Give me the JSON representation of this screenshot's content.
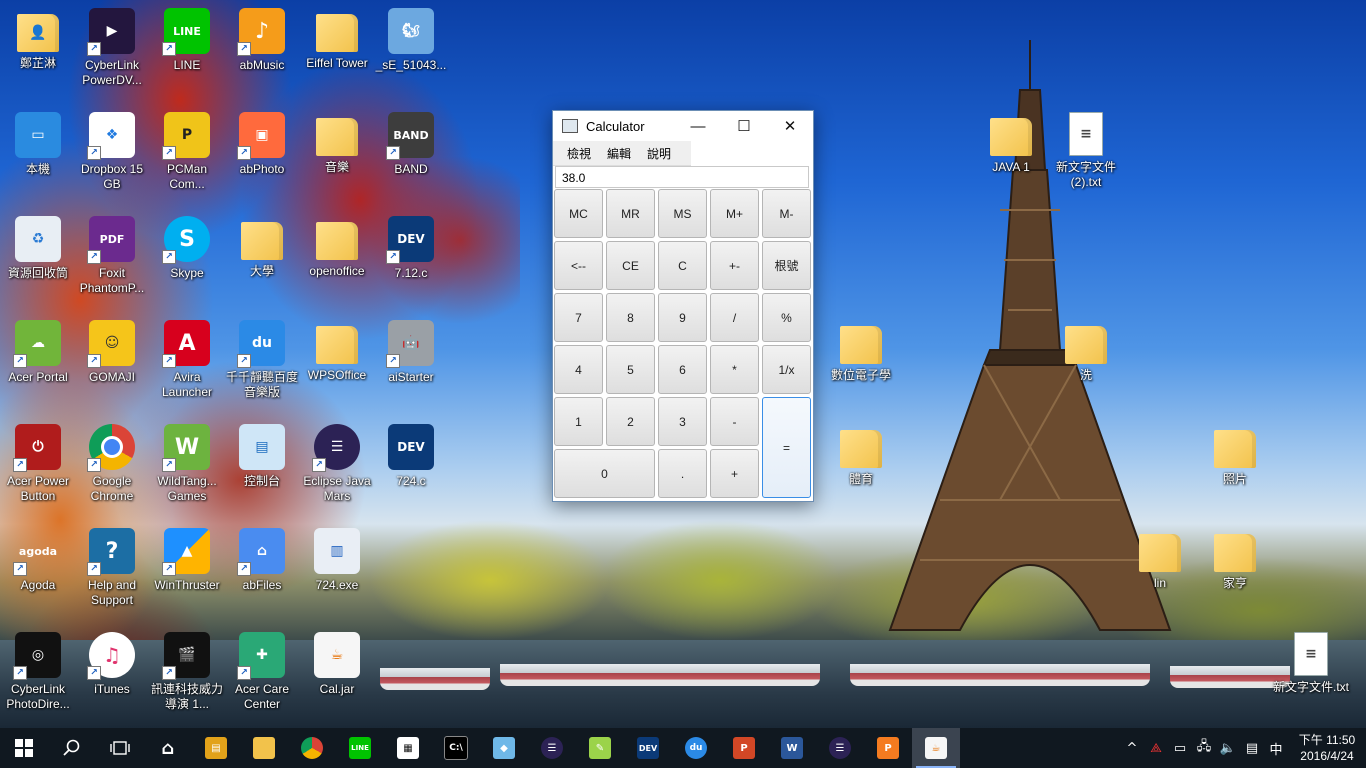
{
  "desktop": {
    "icons": [
      {
        "label": "鄭芷淋"
      },
      {
        "label": "CyberLink PowerDV..."
      },
      {
        "label": "LINE"
      },
      {
        "label": "abMusic"
      },
      {
        "label": "Eiffel Tower"
      },
      {
        "label": "_sE_51043..."
      },
      {
        "label": "本機"
      },
      {
        "label": "Dropbox 15 GB"
      },
      {
        "label": "PCMan Com..."
      },
      {
        "label": "abPhoto"
      },
      {
        "label": "音樂"
      },
      {
        "label": "BAND"
      },
      {
        "label": "資源回收筒"
      },
      {
        "label": "Foxit PhantomP..."
      },
      {
        "label": "Skype"
      },
      {
        "label": "大學"
      },
      {
        "label": "openoffice"
      },
      {
        "label": "7.12.c"
      },
      {
        "label": "Acer Portal"
      },
      {
        "label": "GOMAJI"
      },
      {
        "label": "Avira Launcher"
      },
      {
        "label": "千千靜聽百度音樂版"
      },
      {
        "label": "WPSOffice"
      },
      {
        "label": "aiStarter"
      },
      {
        "label": "Acer Power Button"
      },
      {
        "label": "Google Chrome"
      },
      {
        "label": "WildTang... Games"
      },
      {
        "label": "控制台"
      },
      {
        "label": "Eclipse Java Mars"
      },
      {
        "label": "724.c"
      },
      {
        "label": "Agoda"
      },
      {
        "label": "Help and Support"
      },
      {
        "label": "WinThruster"
      },
      {
        "label": "abFiles"
      },
      {
        "label": "724.exe"
      },
      {
        "label": "CyberLink PhotoDire..."
      },
      {
        "label": "iTunes"
      },
      {
        "label": "訊連科技威力導演 1..."
      },
      {
        "label": "Acer Care Center"
      },
      {
        "label": "Cal.jar"
      },
      {
        "label": "JAVA 1"
      },
      {
        "label": "新文字文件 (2).txt"
      },
      {
        "label": "數位電子學"
      },
      {
        "label": "洗"
      },
      {
        "label": "體育"
      },
      {
        "label": "照片"
      },
      {
        "label": "lin"
      },
      {
        "label": "家亨"
      },
      {
        "label": "新文字文件.txt"
      }
    ]
  },
  "calculator": {
    "title": "Calculator",
    "minimize": "—",
    "maximize": "☐",
    "close": "✕",
    "menu": [
      "檢視",
      "編輯",
      "說明"
    ],
    "display": "38.0",
    "keys": [
      "MC",
      "MR",
      "MS",
      "M+",
      "M-",
      "<--",
      "CE",
      "C",
      "+-",
      "根號",
      "7",
      "8",
      "9",
      "/",
      "%",
      "4",
      "5",
      "6",
      "*",
      "1/x",
      "1",
      "2",
      "3",
      "-",
      "=",
      "0",
      ".",
      "+"
    ]
  },
  "taskbar": {
    "ime": "中",
    "time": "下午 11:50",
    "date": "2016/4/24"
  }
}
